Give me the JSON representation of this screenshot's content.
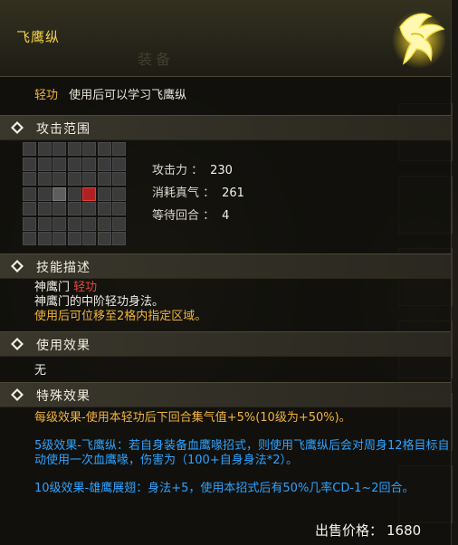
{
  "tooltip": {
    "title": "飞鹰纵",
    "watermark": "装备",
    "skill_type": "轻功",
    "usage_desc": "使用后可以学习飞鹰纵",
    "sections": {
      "range": "攻击范围",
      "skill_desc": "技能描述",
      "use_effect": "使用效果",
      "special_effect": "特殊效果"
    },
    "range_grid": {
      "rows": 7,
      "cols": 7,
      "self_cell": [
        3,
        2
      ],
      "target_cells": [
        [
          3,
          4
        ]
      ]
    },
    "stats": [
      {
        "label": "攻击力 ：",
        "value": "230"
      },
      {
        "label": "消耗真气 ：",
        "value": "261"
      },
      {
        "label": "等待回合 ：",
        "value": "4"
      }
    ],
    "description": {
      "sect": "神鹰门",
      "sect_skill_type": "轻功",
      "line2": "神鹰门的中阶轻功身法。",
      "line3": "使用后可位移至2格内指定区域。"
    },
    "use_effect_text": "无",
    "special_effects": [
      "每级效果-使用本轻功后下回合集气值+5%(10级为+50%)。",
      "5级效果-飞鹰纵：若自身装备血鹰喙招式，则使用飞鹰纵后会对周身12格目标自动使用一次血鹰喙，伤害为（100+自身身法*2）。",
      "10级效果-雄鹰展翅：身法+5，使用本招式后有50%几率CD-1~2回合。"
    ],
    "price_label": "出售价格：",
    "price_value": "1680"
  },
  "colors": {
    "title": "#f4d24a",
    "gold": "#f0b43c",
    "red": "#e8453c",
    "blue": "#2ea3ff",
    "target_cell": "#b02121"
  },
  "icons": {
    "emblem": "eagle-emblem-icon",
    "section_marker": "diamond-icon"
  }
}
